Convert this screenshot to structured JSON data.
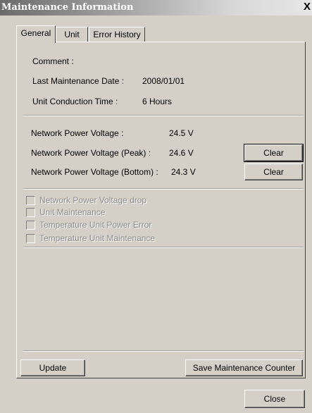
{
  "window": {
    "title": "Maintenance Information",
    "close_label": "X"
  },
  "tabs": [
    {
      "label": "General"
    },
    {
      "label": "Unit"
    },
    {
      "label": "Error History"
    }
  ],
  "info": {
    "comment_label": "Comment :",
    "last_date_label": "Last Maintenance Date :",
    "last_date_value": "2008/01/01",
    "conduction_label": "Unit Conduction Time :",
    "conduction_value": "6 Hours"
  },
  "voltage": {
    "npv_label": "Network Power Voltage :",
    "npv_value": "24.5 V",
    "peak_label": "Network Power Voltage (Peak) :",
    "peak_value": "24.6 V",
    "bottom_label": "Network Power Voltage (Bottom) :",
    "bottom_value": "24.3 V",
    "clear_label": "Clear"
  },
  "checks": [
    {
      "label": "Network Power Voltage drop",
      "checked": false
    },
    {
      "label": "Unit Maintenance",
      "checked": false
    },
    {
      "label": "Temperature Unit Power Error",
      "checked": false
    },
    {
      "label": "Temperature Unit Maintenance",
      "checked": false
    }
  ],
  "buttons": {
    "update": "Update",
    "save_counter": "Save Maintenance Counter",
    "close": "Close"
  }
}
